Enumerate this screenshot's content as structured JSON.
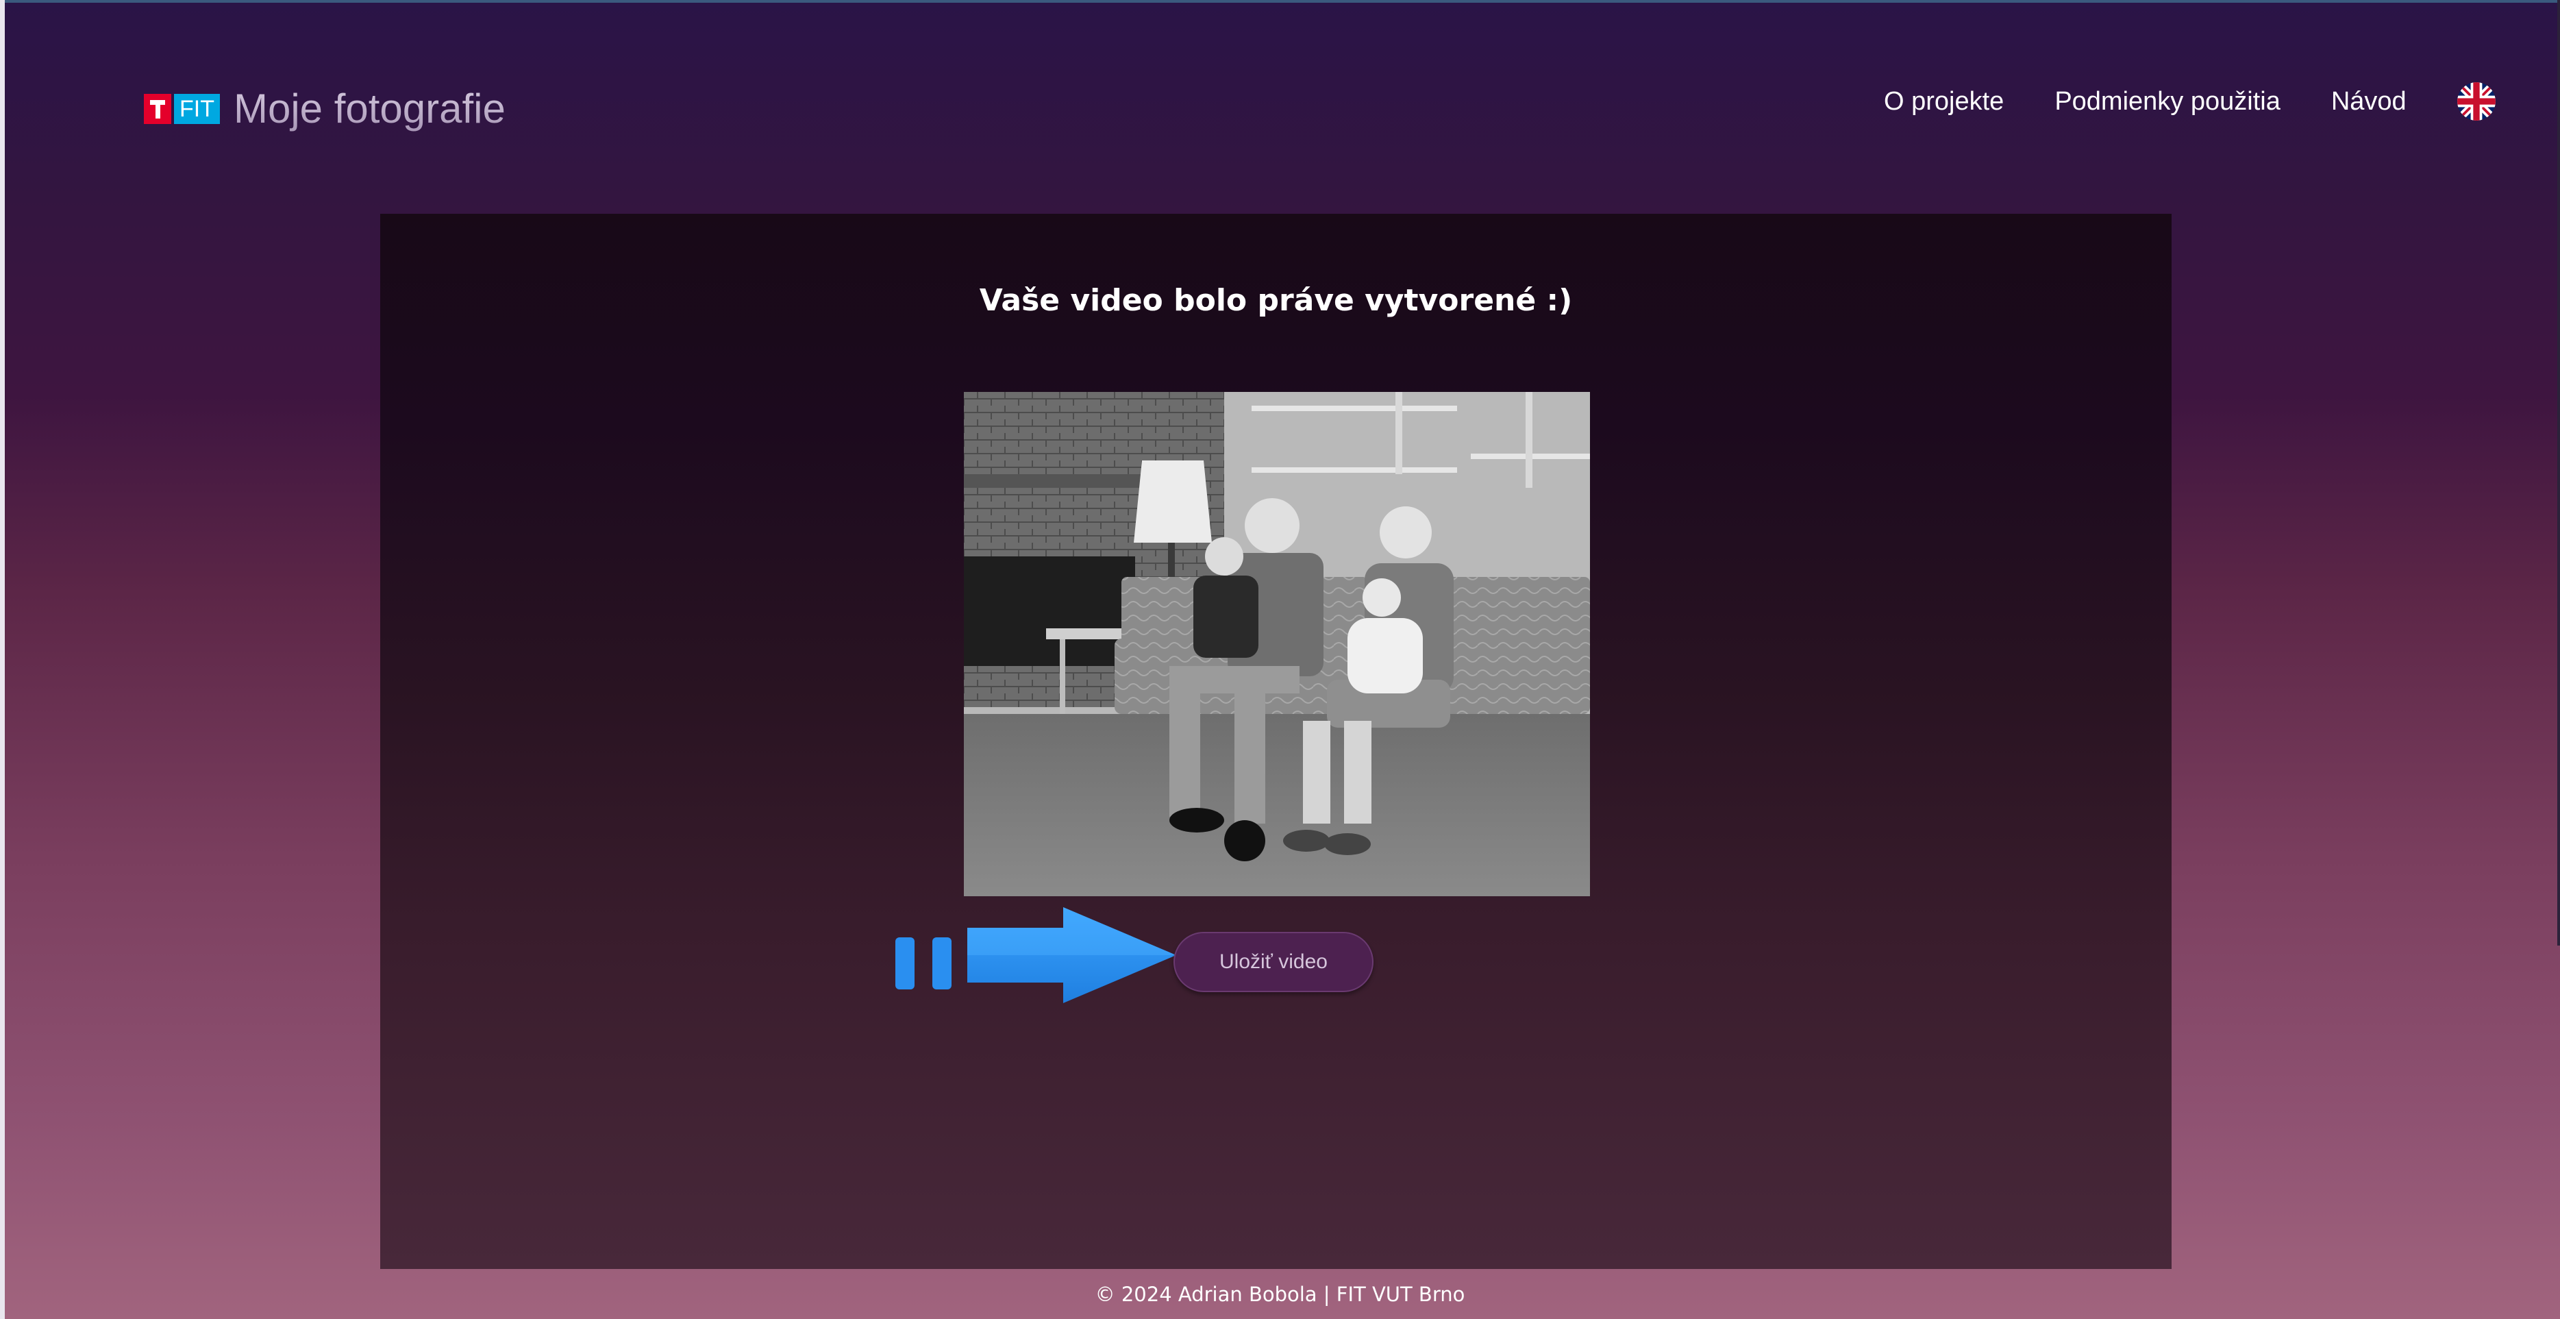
{
  "header": {
    "logo_mark_text": "FIT",
    "site_title": "Moje fotografie",
    "nav": [
      {
        "label": "O projekte"
      },
      {
        "label": "Podmienky použitia"
      },
      {
        "label": "Návod"
      }
    ],
    "language_icon": "uk-flag-icon"
  },
  "main": {
    "title": "Vaše video bolo práve vytvorené :)",
    "preview_icon": "family-photo-preview",
    "player": {
      "pause_icon": "pause-icon",
      "arrow_icon": "arrow-right-icon",
      "save_label": "Uložiť video"
    }
  },
  "footer": {
    "text": "© 2024 Adrian Bobola | FIT VUT Brno"
  },
  "colors": {
    "accent_blue": "#2a8ff0",
    "button_bg": "#4d2150",
    "logo_red": "#e4002b",
    "logo_cyan": "#00a8e1"
  }
}
